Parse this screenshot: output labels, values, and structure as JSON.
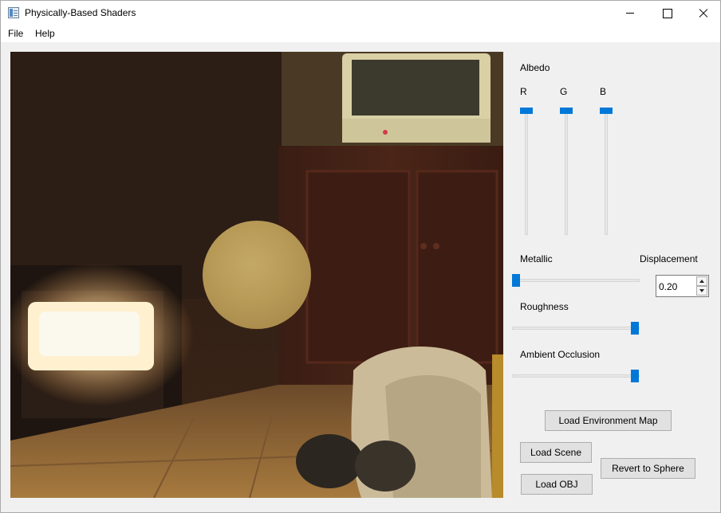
{
  "window": {
    "title": "Physically-Based Shaders",
    "app_icon": "app-window-icon",
    "controls": [
      "minimize-icon",
      "maximize-icon",
      "close-icon"
    ]
  },
  "menu": {
    "file": "File",
    "help": "Help"
  },
  "viewport": {
    "description_icon": "rendered-scene",
    "sphere_color": "#b89a57"
  },
  "albedo": {
    "label": "Albedo",
    "r_label": "R",
    "g_label": "G",
    "b_label": "B",
    "r_value": 1.0,
    "g_value": 1.0,
    "b_value": 1.0
  },
  "metallic": {
    "label": "Metallic",
    "value": 0.0
  },
  "displacement": {
    "label": "Displacement",
    "value": "0.20"
  },
  "roughness": {
    "label": "Roughness",
    "value": 1.0
  },
  "ambient_occlusion": {
    "label": "Ambient Occlusion",
    "value": 1.0
  },
  "buttons": {
    "load_env": "Load Environment Map",
    "load_scene": "Load Scene",
    "load_obj": "Load OBJ",
    "revert": "Revert to Sphere"
  },
  "colors": {
    "accent": "#0078d7",
    "button_bg": "#e1e1e1",
    "panel_bg": "#f0f0f0"
  }
}
